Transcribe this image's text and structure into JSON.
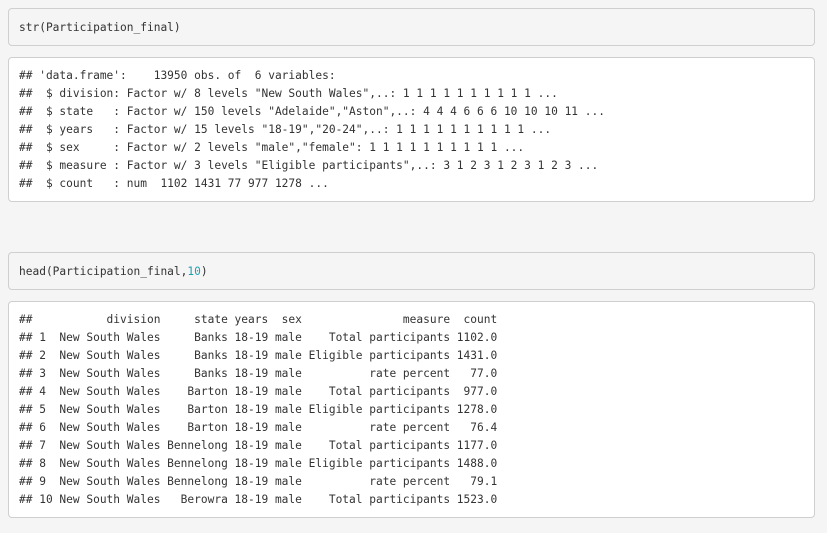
{
  "cells": [
    {
      "input": "str(Participation_final)",
      "output": [
        "## 'data.frame':    13950 obs. of  6 variables:",
        "##  $ division: Factor w/ 8 levels \"New South Wales\",..: 1 1 1 1 1 1 1 1 1 1 ...",
        "##  $ state   : Factor w/ 150 levels \"Adelaide\",\"Aston\",..: 4 4 4 6 6 6 10 10 10 11 ...",
        "##  $ years   : Factor w/ 15 levels \"18-19\",\"20-24\",..: 1 1 1 1 1 1 1 1 1 1 ...",
        "##  $ sex     : Factor w/ 2 levels \"male\",\"female\": 1 1 1 1 1 1 1 1 1 1 ...",
        "##  $ measure : Factor w/ 3 levels \"Eligible participants\",..: 3 1 2 3 1 2 3 1 2 3 ...",
        "##  $ count   : num  1102 1431 77 977 1278 ..."
      ]
    },
    {
      "input_fn": "head(Participation_final,",
      "input_arg": "10",
      "input_close": ")",
      "output": [
        "##           division     state years  sex               measure  count",
        "## 1  New South Wales     Banks 18-19 male    Total participants 1102.0",
        "## 2  New South Wales     Banks 18-19 male Eligible participants 1431.0",
        "## 3  New South Wales     Banks 18-19 male          rate percent   77.0",
        "## 4  New South Wales    Barton 18-19 male    Total participants  977.0",
        "## 5  New South Wales    Barton 18-19 male Eligible participants 1278.0",
        "## 6  New South Wales    Barton 18-19 male          rate percent   76.4",
        "## 7  New South Wales Bennelong 18-19 male    Total participants 1177.0",
        "## 8  New South Wales Bennelong 18-19 male Eligible participants 1488.0",
        "## 9  New South Wales Bennelong 18-19 male          rate percent   79.1",
        "## 10 New South Wales   Berowra 18-19 male    Total participants 1523.0"
      ]
    }
  ]
}
